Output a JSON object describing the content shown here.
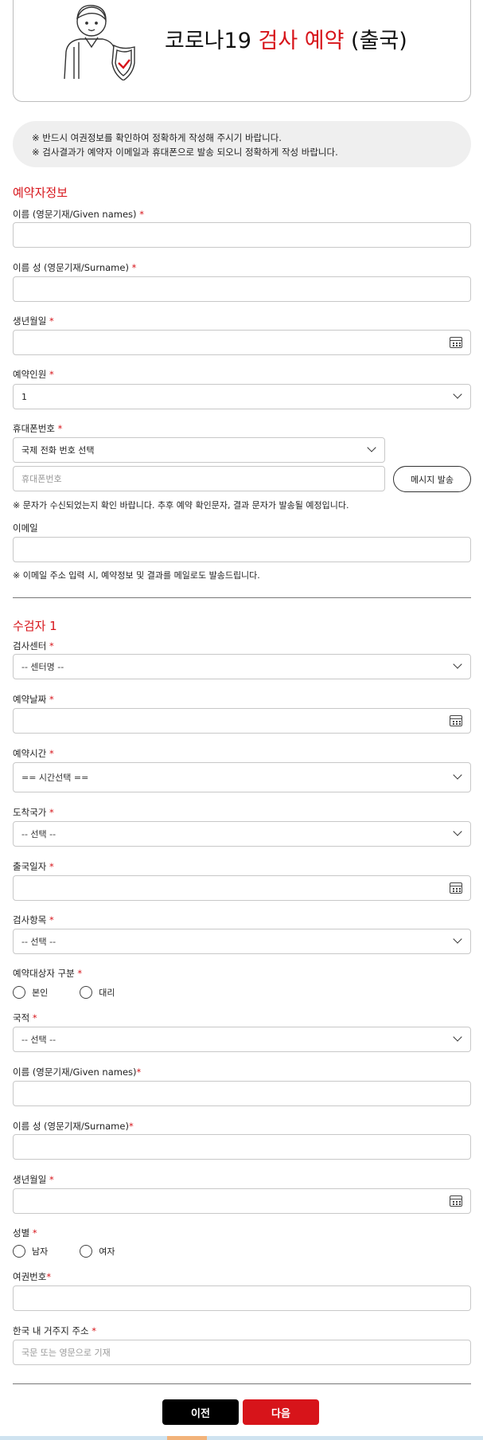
{
  "header": {
    "title_black": "코로나19",
    "title_red": "검사 예약",
    "title_paren": "(출국)"
  },
  "notice": {
    "line1": "※ 반드시 여권정보를 확인하여 정확하게 작성해 주시기 바랍니다.",
    "line2": "※ 검사결과가 예약자 이메일과 휴대폰으로 발송 되오니 정확하게 작성 바랍니다."
  },
  "booker": {
    "section_title": "예약자정보",
    "given_name_label": "이름 (영문기재/Given names)",
    "surname_label": "이름 성 (영문기재/Surname)",
    "birth_label": "생년월일",
    "people_label": "예약인원",
    "people_value": "1",
    "phone_label": "휴대폰번호",
    "country_code_value": "국제 전화 번호 선택",
    "phone_placeholder": "휴대폰번호",
    "send_button": "메시지 발송",
    "phone_hint": "※ 문자가 수신되었는지 확인 바랍니다. 추후 예약 확인문자, 결과 문자가 발송될 예정입니다.",
    "email_label": "이메일",
    "email_hint": "※ 이메일 주소 입력 시, 예약정보 및 결과를 메일로도 발송드립니다."
  },
  "examinee": {
    "section_title": "수검자 1",
    "center_label": "검사센터",
    "center_value": "-- 센터명 --",
    "date_label": "예약날짜",
    "time_label": "예약시간",
    "time_value": "== 시간선택 ==",
    "arrival_label": "도착국가",
    "arrival_value": "-- 선택 --",
    "departure_label": "출국일자",
    "test_label": "검사항목",
    "test_value": "-- 선택 --",
    "target_label": "예약대상자 구분",
    "target_options": [
      "본인",
      "대리"
    ],
    "nationality_label": "국적",
    "nationality_value": "-- 선택 --",
    "given_name_label": "이름 (영문기재/Given names)",
    "surname_label": "이름 성 (영문기재/Surname)",
    "birth_label": "생년월일",
    "gender_label": "성별",
    "gender_options": [
      "남자",
      "여자"
    ],
    "passport_label": "여권번호",
    "address_label": "한국 내 거주지 주소",
    "address_placeholder": "국문 또는 영문으로 기재"
  },
  "required_mark": "*",
  "buttons": {
    "prev": "이전",
    "next": "다음"
  },
  "colors": {
    "accent": "#d7141a",
    "notice_bg": "#efefef"
  }
}
